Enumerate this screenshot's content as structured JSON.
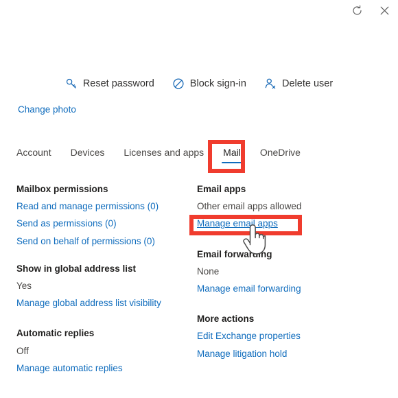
{
  "window": {
    "refresh_icon": "refresh-icon",
    "close_icon": "close-icon"
  },
  "commandbar": {
    "items": [
      {
        "label": "Reset password",
        "icon": "key-icon"
      },
      {
        "label": "Block sign-in",
        "icon": "block-icon"
      },
      {
        "label": "Delete user",
        "icon": "delete-user-icon"
      }
    ]
  },
  "profile": {
    "change_photo_label": "Change photo"
  },
  "tabs": {
    "items": [
      {
        "label": "Account",
        "selected": false
      },
      {
        "label": "Devices",
        "selected": false
      },
      {
        "label": "Licenses and apps",
        "selected": false
      },
      {
        "label": "Mail",
        "selected": true
      },
      {
        "label": "OneDrive",
        "selected": false
      }
    ]
  },
  "left_column": {
    "mailbox_permissions": {
      "title": "Mailbox permissions",
      "links": [
        "Read and manage permissions (0)",
        "Send as permissions (0)",
        "Send on behalf of permissions (0)"
      ]
    },
    "global_address_list": {
      "title": "Show in global address list",
      "value": "Yes",
      "link": "Manage global address list visibility"
    },
    "automatic_replies": {
      "title": "Automatic replies",
      "value": "Off",
      "link": "Manage automatic replies"
    }
  },
  "right_column": {
    "email_apps": {
      "title": "Email apps",
      "value": "Other email apps allowed",
      "link": "Manage email apps"
    },
    "email_forwarding": {
      "title": "Email forwarding",
      "value": "None",
      "link": "Manage email forwarding"
    },
    "more_actions": {
      "title": "More actions",
      "links": [
        "Edit Exchange properties",
        "Manage litigation hold"
      ]
    }
  },
  "annotations": {
    "color": "#f03c2e",
    "targets": [
      "Mail",
      "Manage email apps"
    ],
    "cursor": "hand-pointer-cursor"
  },
  "colors": {
    "link": "#0f6cbd",
    "accent": "#0f6cbd",
    "text": "#323130",
    "annotation_red": "#f03c2e"
  }
}
